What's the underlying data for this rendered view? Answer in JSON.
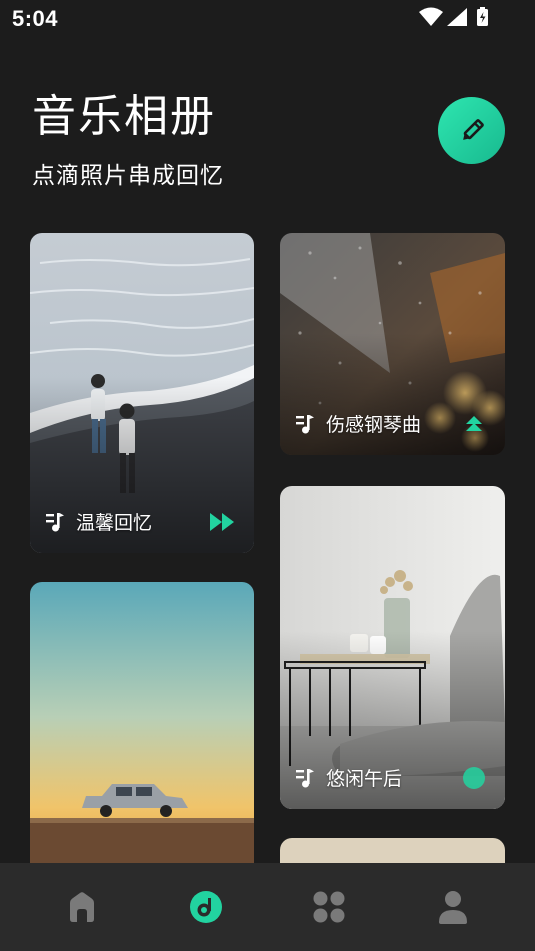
{
  "status_bar": {
    "time": "5:04"
  },
  "header": {
    "title": "音乐相册",
    "subtitle": "点滴照片串成回忆"
  },
  "albums": [
    {
      "label": "温馨回忆",
      "action_icon": "play-forward-icon"
    },
    {
      "label": "伤感钢琴曲",
      "action_icon": "eject-icon"
    },
    {
      "label": "",
      "action_icon": ""
    },
    {
      "label": "悠闲午后",
      "action_icon": "dot-icon"
    },
    {
      "label": "",
      "action_icon": ""
    }
  ],
  "nav": {
    "items": [
      {
        "icon": "home-icon",
        "active": false
      },
      {
        "icon": "music-disc-icon",
        "active": true
      },
      {
        "icon": "apps-icon",
        "active": false
      },
      {
        "icon": "profile-icon",
        "active": false
      }
    ]
  },
  "colors": {
    "accent": "#22d3a0",
    "background": "#1c1c1c",
    "nav_background": "#2b2b2b",
    "inactive_icon": "#7a7a7a"
  }
}
